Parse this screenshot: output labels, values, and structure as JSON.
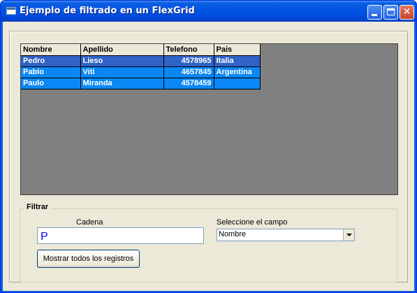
{
  "window": {
    "title": "Ejemplo de filtrado en un FlexGrid",
    "icon": "app-window-icon",
    "controls": [
      "minimize-icon",
      "maximize-icon",
      "close-icon"
    ]
  },
  "grid": {
    "columns": [
      "Nombre",
      "Apellido",
      "Telefono",
      "Pais"
    ],
    "rows": [
      {
        "nombre": "Pedro",
        "apellido": "Lieso",
        "telefono": "4578965",
        "pais": "Italia",
        "selected": true
      },
      {
        "nombre": "Pablo",
        "apellido": "Viti",
        "telefono": "4657845",
        "pais": "Argentina"
      },
      {
        "nombre": "Paulo",
        "apellido": "Miranda",
        "telefono": "4578459",
        "pais": ""
      }
    ]
  },
  "filter": {
    "group_label": "Filtrar",
    "cadena_label": "Cadena",
    "cadena_value": "P",
    "campo_label": "Seleccione el campo",
    "campo_value": "Nombre",
    "show_all_label": "Mostrar todos los registros"
  },
  "colors": {
    "titlebar": "#0054e3",
    "row_highlight": "#0b87f5",
    "row_selected": "#3163c6",
    "grid_background": "#808080",
    "dialog_face": "#ece9d8"
  }
}
